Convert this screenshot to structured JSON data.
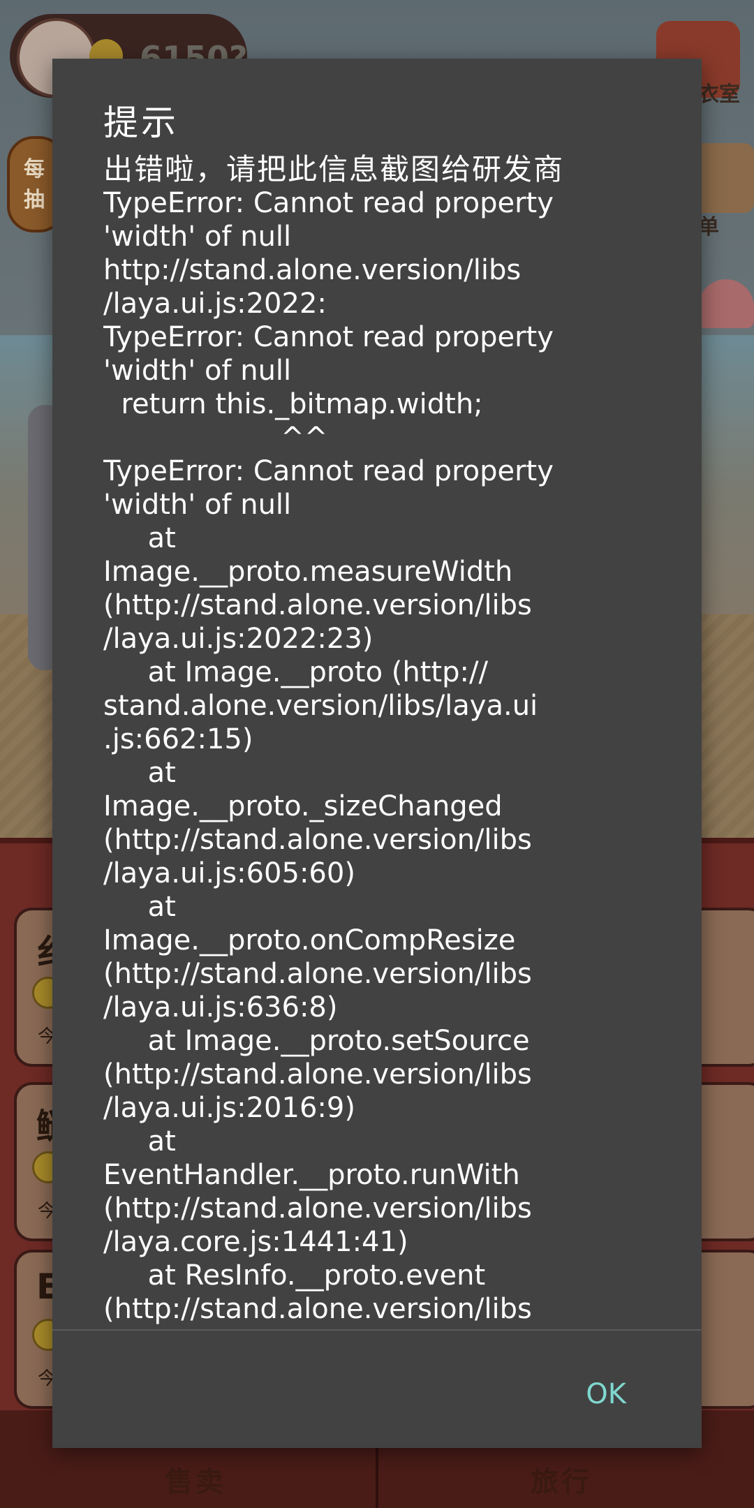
{
  "background": {
    "coin_count": "6150?",
    "daily_label": "每抽",
    "shirt_label": "衣室",
    "menu_label": "单",
    "tabs": [
      {
        "label": "售卖"
      },
      {
        "label": "旅行"
      }
    ]
  },
  "dialog": {
    "title": "提示",
    "header": "出错啦，请把此信息截图给研发商",
    "body": "TypeError: Cannot read property\n'width' of null\nhttp://stand.alone.version/libs\n/laya.ui.js:2022:\nTypeError: Cannot read property\n'width' of null\n  return this._bitmap.width;\n                    ^^\nTypeError: Cannot read property\n'width' of null\n     at\nImage.__proto.measureWidth\n(http://stand.alone.version/libs\n/laya.ui.js:2022:23)\n     at Image.__proto (http://\nstand.alone.version/libs/laya.ui\n.js:662:15)\n     at\nImage.__proto._sizeChanged\n(http://stand.alone.version/libs\n/laya.ui.js:605:60)\n     at\nImage.__proto.onCompResize\n(http://stand.alone.version/libs\n/laya.ui.js:636:8)\n     at Image.__proto.setSource\n(http://stand.alone.version/libs\n/laya.ui.js:2016:9)\n     at\nEventHandler.__proto.runWith\n(http://stand.alone.version/libs\n/laya.core.js:1441:41)\n     at ResInfo.__proto.event\n(http://stand.alone.version/libs",
    "ok_label": "OK"
  }
}
